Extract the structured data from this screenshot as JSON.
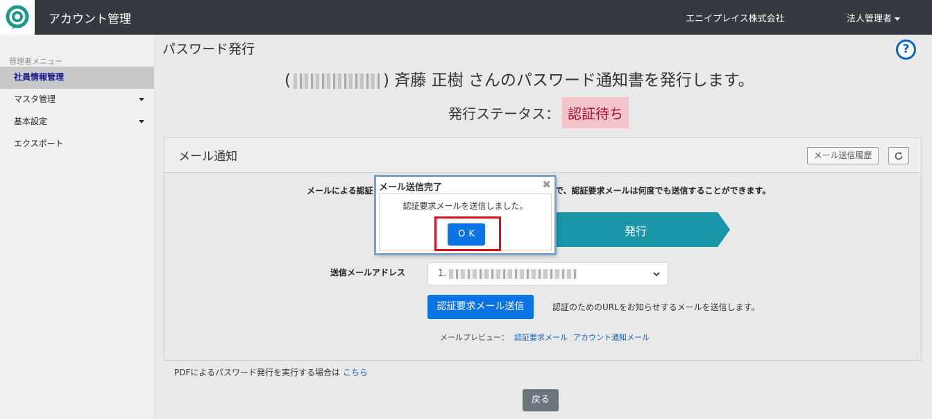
{
  "header": {
    "app_title": "アカウント管理",
    "company": "エニイプレイス株式会社",
    "user_menu": "法人管理者"
  },
  "sidebar": {
    "title": "管理者メニュー",
    "items": [
      {
        "label": "社員情報管理",
        "active": true
      },
      {
        "label": "マスタ管理",
        "has_submenu": true
      },
      {
        "label": "基本設定",
        "has_submenu": true
      },
      {
        "label": "エクスポート"
      }
    ]
  },
  "page": {
    "title": "パスワード発行",
    "headline_open": "(",
    "headline_close": ")",
    "headline_rest": "斉藤 正樹 さんのパスワード通知書を発行します。",
    "status_label": "発行ステータス：",
    "status_value": "認証待ち"
  },
  "card": {
    "title": "メール通知",
    "history_button": "メール送信履歴",
    "notice_left": "メールによる認証",
    "notice_right": "で、認証要求メールは何度でも送信することができます。",
    "step_label": "発行",
    "address_label": "送信メールアドレス",
    "address_prefix": "1.",
    "send_button": "認証要求メール送信",
    "send_description": "認証のためのURLをお知らせするメールを送信します。",
    "preview_label": "メールプレビュー：",
    "preview_links": [
      "認証要求メール",
      "アカウント通知メール"
    ]
  },
  "footer": {
    "pdf_text": "PDFによるパスワード発行を実行する場合は",
    "pdf_link": "こちら",
    "back_button": "戻る"
  },
  "dialog": {
    "title": "メール送信完了",
    "close_glyph": "✖",
    "message": "認証要求メールを送信しました。",
    "ok_button": "OK"
  },
  "colors": {
    "topbar": "#343a40",
    "primary": "#0b74e5",
    "step": "#1b95a8",
    "status_bg": "#f2c4c9",
    "status_text": "#a1112d",
    "highlight": "#d9101a"
  }
}
